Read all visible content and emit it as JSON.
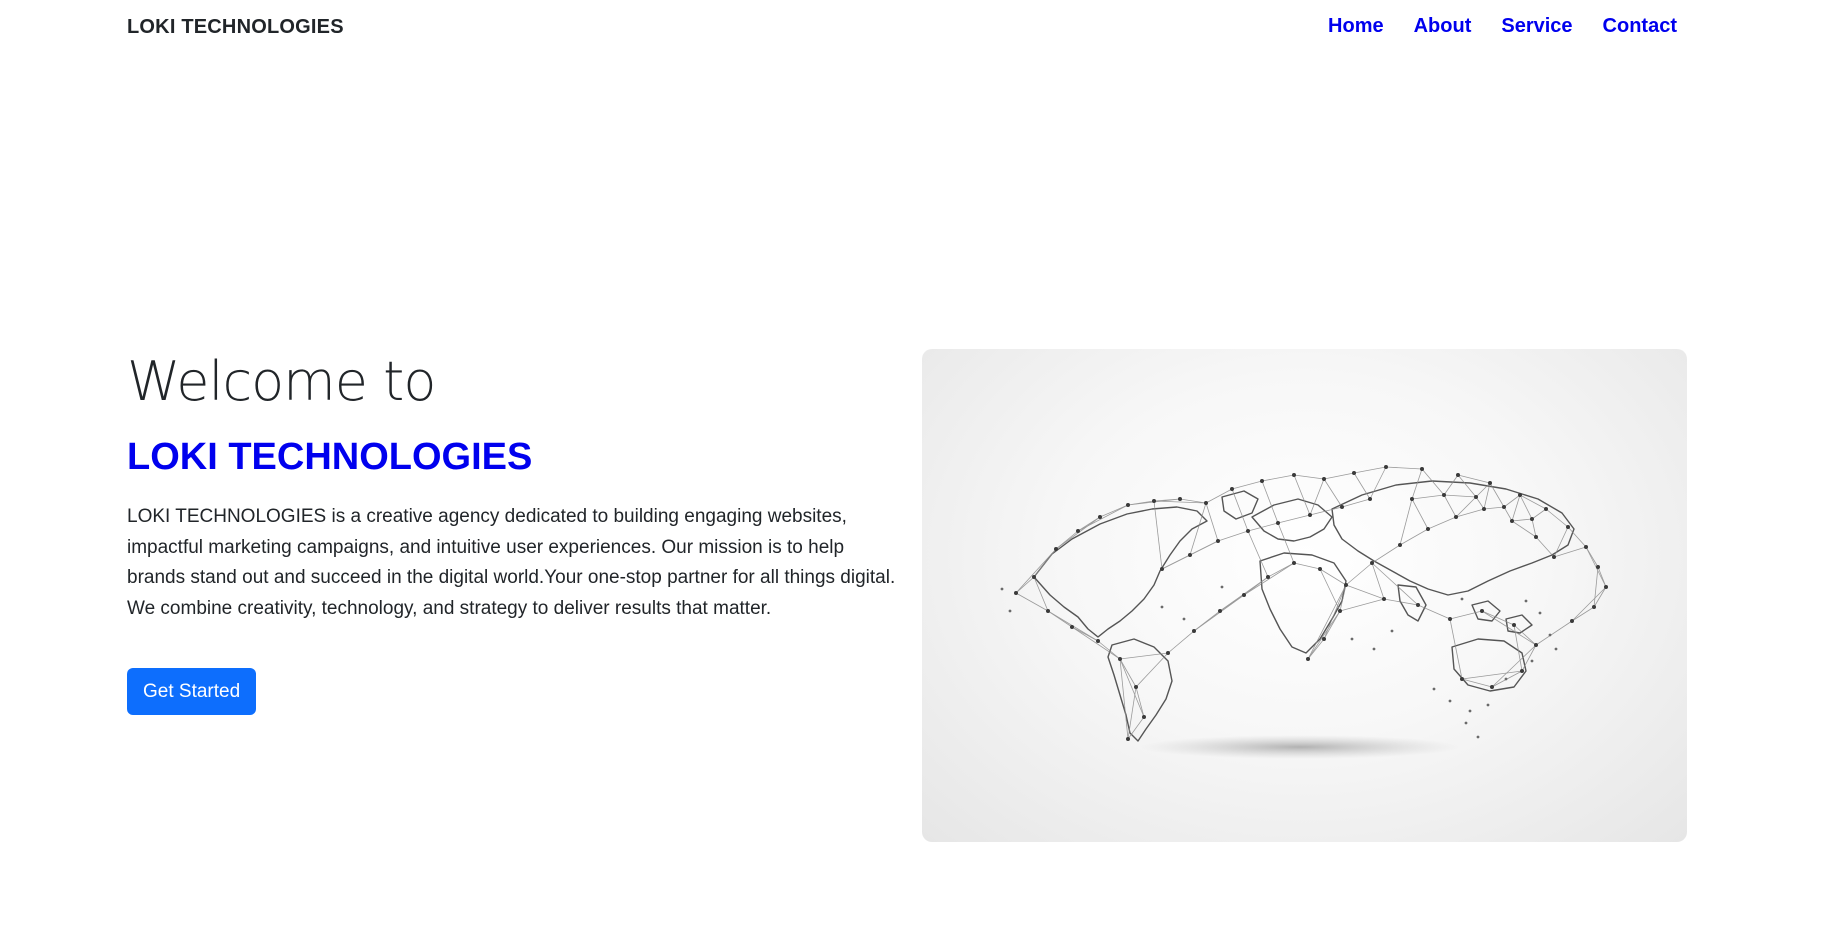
{
  "navbar": {
    "brand": "LOKI TECHNOLOGIES",
    "links": [
      "Home",
      "About",
      "Service",
      "Contact"
    ],
    "link_color": "#0000ee"
  },
  "hero": {
    "welcome": "Welcome to",
    "company": "LOKI TECHNOLOGIES",
    "description": "LOKI TECHNOLOGIES is a creative agency dedicated to building engaging websites, impactful marketing campaigns, and intuitive user experiences. Our mission is to help brands stand out and succeed in the digital world.Your one-stop partner for all things digital. We combine creativity, technology, and strategy to deliver results that matter.",
    "cta_label": "Get Started",
    "cta_color": "#0d6efd",
    "image_icon": "world-network-map-icon"
  }
}
